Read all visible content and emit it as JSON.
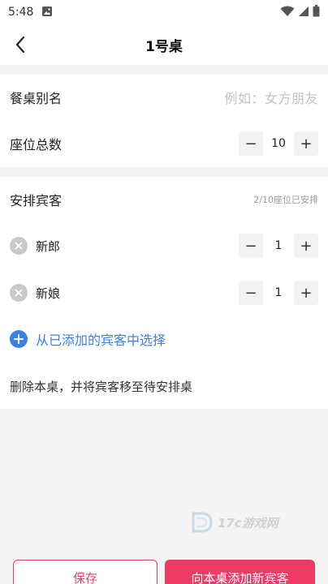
{
  "status_bar": {
    "time": "5:48"
  },
  "header": {
    "title": "1号桌"
  },
  "table_info": {
    "alias_label": "餐桌别名",
    "alias_placeholder": "例如：女方朋友",
    "seats_label": "座位总数",
    "seats_value": "10",
    "minus": "−",
    "plus": "+"
  },
  "guests": {
    "section_label": "安排宾客",
    "summary": "2/10座位已安排",
    "items": [
      {
        "name": "新郎",
        "count": "1"
      },
      {
        "name": "新娘",
        "count": "1"
      }
    ],
    "add_from_list": "从已添加的宾客中选择",
    "delete_table": "删除本桌，并将宾客移至待安排桌"
  },
  "footer": {
    "save_label": "保存",
    "add_new_guest_label": "向本桌添加新宾客"
  },
  "watermark": {
    "text": "17c游戏网"
  },
  "colors": {
    "accent": "#ee3b66",
    "link": "#3c7fe6"
  }
}
